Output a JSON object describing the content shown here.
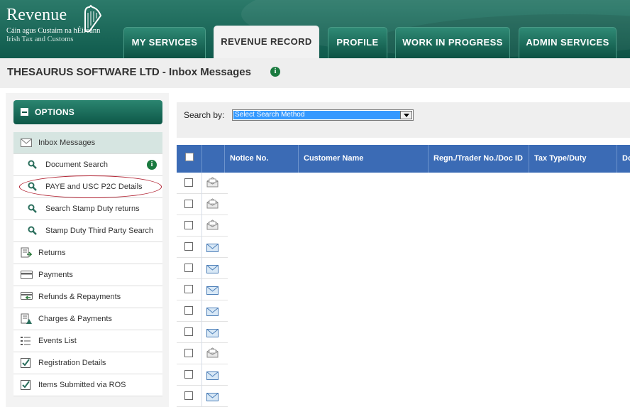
{
  "brand": {
    "title": "Revenue",
    "subtitle_line1": "Cáin agus Custaim na hÉireann",
    "subtitle_line2": "Irish Tax and Customs"
  },
  "tabs": [
    {
      "label": "MY SERVICES",
      "active": false
    },
    {
      "label": "REVENUE RECORD",
      "active": true
    },
    {
      "label": "PROFILE",
      "active": false
    },
    {
      "label": "WORK IN PROGRESS",
      "active": false
    },
    {
      "label": "ADMIN SERVICES",
      "active": false
    }
  ],
  "page": {
    "title": "THESAURUS SOFTWARE LTD - Inbox Messages",
    "info_icon": "i"
  },
  "sidebar": {
    "options_label": "OPTIONS",
    "items": [
      {
        "label": "Inbox Messages",
        "icon": "envelope-icon",
        "active": true
      },
      {
        "label": "Document Search",
        "icon": "search-icon",
        "info": "i"
      },
      {
        "label": "PAYE and USC P2C Details",
        "icon": "search-icon",
        "highlighted": true
      },
      {
        "label": "Search Stamp Duty returns",
        "icon": "search-icon"
      },
      {
        "label": "Stamp Duty Third Party Search",
        "icon": "search-icon"
      },
      {
        "label": "Returns",
        "icon": "returns-icon"
      },
      {
        "label": "Payments",
        "icon": "payment-card-icon"
      },
      {
        "label": "Refunds & Repayments",
        "icon": "refund-icon"
      },
      {
        "label": "Charges & Payments",
        "icon": "charges-icon"
      },
      {
        "label": "Events List",
        "icon": "list-icon"
      },
      {
        "label": "Registration Details",
        "icon": "checkbox-icon"
      },
      {
        "label": "Items Submitted via ROS",
        "icon": "checkbox-icon"
      }
    ]
  },
  "search": {
    "label": "Search by:",
    "selected": "Select Search Method"
  },
  "grid": {
    "columns": [
      "",
      "",
      "Notice No.",
      "Customer Name",
      "Regn./Trader No./Doc ID",
      "Tax Type/Duty",
      "Do"
    ],
    "rows": [
      {
        "read": true
      },
      {
        "read": true
      },
      {
        "read": true
      },
      {
        "read": false
      },
      {
        "read": false
      },
      {
        "read": false
      },
      {
        "read": false
      },
      {
        "read": false
      },
      {
        "read": true
      },
      {
        "read": false
      },
      {
        "read": false
      }
    ]
  },
  "colors": {
    "header_green": "#0f5a4c",
    "grid_header_blue": "#3b6bb5",
    "active_nav": "#d6e5e1",
    "highlight_oval": "#b02030",
    "info_green": "#1a7a3f"
  }
}
